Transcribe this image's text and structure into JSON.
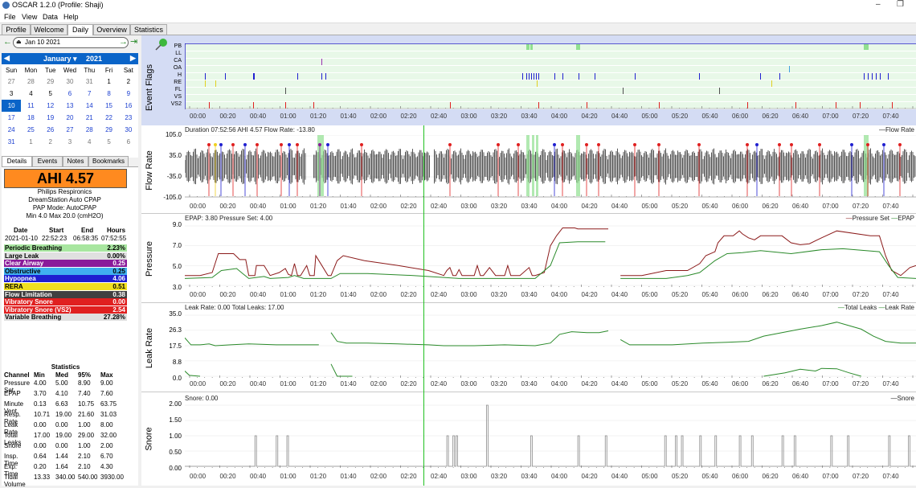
{
  "window": {
    "title": "OSCAR 1.2.0 (Profile: Shaji)",
    "minimize": "–",
    "restore": "❐"
  },
  "menu": [
    "File",
    "View",
    "Data",
    "Help"
  ],
  "tabs": [
    "Profile",
    "Welcome",
    "Daily",
    "Overview",
    "Statistics"
  ],
  "active_tab": "Daily",
  "datenav": {
    "date": "Jan 10 2021",
    "prev_icon": "back-arrow-icon",
    "next_icon": "forward-arrow-icon",
    "last_icon": "jump-end-icon"
  },
  "calendar": {
    "month": "January",
    "year": "2021",
    "weekdays": [
      "Sun",
      "Mon",
      "Tue",
      "Wed",
      "Thu",
      "Fri",
      "Sat"
    ],
    "weeks": [
      [
        "27",
        "28",
        "29",
        "30",
        "31",
        "1",
        "2"
      ],
      [
        "3",
        "4",
        "5",
        "6",
        "7",
        "8",
        "9"
      ],
      [
        "10",
        "11",
        "12",
        "13",
        "14",
        "15",
        "16"
      ],
      [
        "17",
        "18",
        "19",
        "20",
        "21",
        "22",
        "23"
      ],
      [
        "24",
        "25",
        "26",
        "27",
        "28",
        "29",
        "30"
      ],
      [
        "31",
        "1",
        "2",
        "3",
        "4",
        "5",
        "6"
      ]
    ],
    "selected": "10"
  },
  "subtabs": [
    "Details",
    "Events",
    "Notes",
    "Bookmarks"
  ],
  "ahi": "AHI 4.57",
  "device": [
    "Philips Respironics",
    "DreamStation Auto CPAP",
    "PAP Mode: AutoCPAP",
    "Min 4.0 Max 20.0 (cmH2O)"
  ],
  "session": {
    "headers": [
      "Date",
      "Start",
      "End",
      "Hours"
    ],
    "row": [
      "2021-01-10",
      "22:52:23",
      "06:58:35",
      "07:52:55"
    ]
  },
  "events": [
    {
      "name": "Periodic Breathing",
      "value": "2.23%",
      "color": "#a8e6a0",
      "text": "#000"
    },
    {
      "name": "Large Leak",
      "value": "0.00%",
      "color": "#e0e0e0",
      "text": "#000"
    },
    {
      "name": "Clear Airway",
      "value": "0.25",
      "color": "#8a1a9a",
      "text": "#fff"
    },
    {
      "name": "Obstructive",
      "value": "0.25",
      "color": "#40b0f0",
      "text": "#000"
    },
    {
      "name": "Hypopnea",
      "value": "4.06",
      "color": "#1f1fd0",
      "text": "#fff"
    },
    {
      "name": "RERA",
      "value": "0.51",
      "color": "#f0e020",
      "text": "#000"
    },
    {
      "name": "Flow Limitation",
      "value": "0.38",
      "color": "#404040",
      "text": "#fff"
    },
    {
      "name": "Vibratory Snore",
      "value": "0.00",
      "color": "#e02020",
      "text": "#fff"
    },
    {
      "name": "Vibratory Snore (VS2)",
      "value": "2.54",
      "color": "#e02020",
      "text": "#fff"
    },
    {
      "name": "Variable Breathing",
      "value": "27.28%",
      "color": "#e0e0e0",
      "text": "#000"
    }
  ],
  "stats": {
    "title": "Statistics",
    "headers": [
      "Channel",
      "Min",
      "Med",
      "95%",
      "Max"
    ],
    "rows": [
      {
        "l1": "Pressure",
        "l2": "Set",
        "v": [
          "4.00",
          "5.00",
          "8.90",
          "9.00"
        ]
      },
      {
        "l1": "EPAP",
        "l2": "",
        "v": [
          "3.70",
          "4.10",
          "7.40",
          "7.60"
        ]
      },
      {
        "l1": "Minute",
        "l2": "Vent.",
        "v": [
          "0.13",
          "6.63",
          "10.75",
          "63.75"
        ]
      },
      {
        "l1": "Resp.",
        "l2": "Rate",
        "v": [
          "10.71",
          "19.00",
          "21.60",
          "31.03"
        ]
      },
      {
        "l1": "Leak",
        "l2": "Rate",
        "v": [
          "0.00",
          "0.00",
          "1.00",
          "8.00"
        ]
      },
      {
        "l1": "Total",
        "l2": "Leaks",
        "v": [
          "17.00",
          "19.00",
          "29.00",
          "32.00"
        ]
      },
      {
        "l1": "Snore",
        "l2": "",
        "v": [
          "0.00",
          "0.00",
          "1.00",
          "2.00"
        ]
      },
      {
        "l1": "Insp.",
        "l2": "Time",
        "v": [
          "0.64",
          "1.44",
          "2.10",
          "6.70"
        ]
      },
      {
        "l1": "Exp.",
        "l2": "Time",
        "v": [
          "0.20",
          "1.64",
          "2.10",
          "4.30"
        ]
      },
      {
        "l1": "Tidal",
        "l2": "Volume",
        "v": [
          "13.33",
          "340.00",
          "540.00",
          "3930.00"
        ]
      }
    ]
  },
  "time_ticks": [
    "00:00",
    "00:20",
    "00:40",
    "01:00",
    "01:20",
    "01:40",
    "02:00",
    "02:20",
    "02:40",
    "03:00",
    "03:20",
    "03:40",
    "04:00",
    "04:20",
    "04:40",
    "05:00",
    "05:20",
    "05:40",
    "06:00",
    "06:20",
    "06:40",
    "07:00",
    "07:20",
    "07:40"
  ],
  "event_flags": {
    "label": "Event Flags",
    "rows": [
      "PB",
      "LL",
      "CA",
      "OA",
      "H",
      "RE",
      "FL",
      "VS",
      "VS2"
    ],
    "colors": {
      "PB": "#90e090",
      "LL": "#a0a0a0",
      "CA": "#9a30b0",
      "OA": "#40a0e0",
      "H": "#2020d0",
      "RE": "#e0d020",
      "FL": "#505050",
      "VS": "#e02020",
      "VS2": "#e02020"
    }
  },
  "flow": {
    "label": "Flow Rate",
    "header": "Duration 07:52:56 AHI 4.57 Flow Rate: -13.80",
    "legend": "Flow Rate",
    "yticks": [
      "105.0",
      "35.0",
      "-35.0",
      "-105.0"
    ]
  },
  "pressure": {
    "label": "Pressure",
    "header": "EPAP: 3.80 Pressure Set: 4.00",
    "legend": [
      "Pressure Set",
      "EPAP"
    ],
    "yticks": [
      "9.0",
      "7.0",
      "5.0",
      "3.0"
    ],
    "colors": {
      "set": "#8b1a1a",
      "epap": "#2a8a2a"
    }
  },
  "leak": {
    "label": "Leak Rate",
    "header": "Leak Rate: 0.00 Total Leaks: 17.00",
    "legend": [
      "Total Leaks",
      "Leak Rate"
    ],
    "yticks": [
      "35.0",
      "26.3",
      "17.5",
      "8.8",
      "0.0"
    ]
  },
  "snore": {
    "label": "Snore",
    "header": "Snore: 0.00",
    "legend": "Snore",
    "yticks": [
      "2.00",
      "1.50",
      "1.00",
      "0.50",
      "0.00"
    ]
  }
}
